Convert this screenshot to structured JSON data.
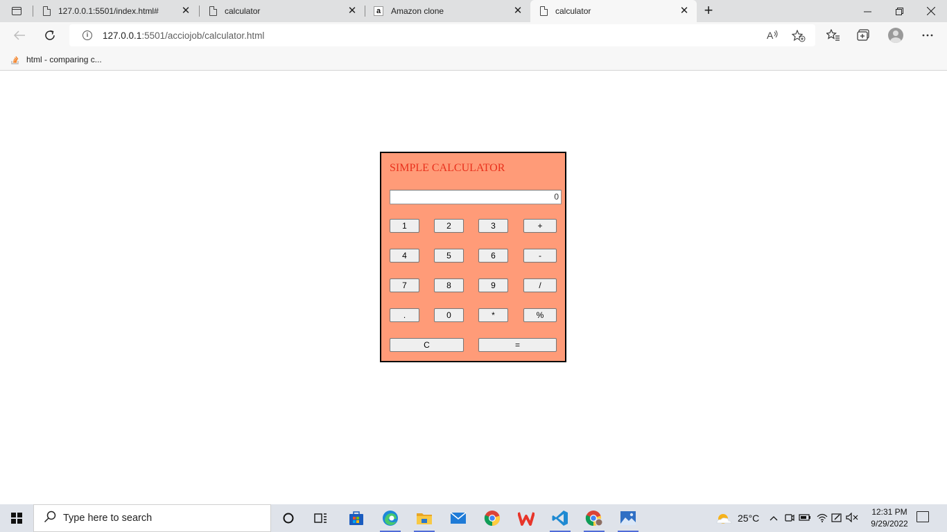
{
  "browser": {
    "tabs": [
      {
        "label": "127.0.0.1:5501/index.html#",
        "icon": "page-icon",
        "active": false
      },
      {
        "label": "calculator",
        "icon": "page-icon",
        "active": false
      },
      {
        "label": "Amazon clone",
        "icon": "amazon-icon",
        "active": false
      },
      {
        "label": "calculator",
        "icon": "page-icon",
        "active": true
      }
    ],
    "address": {
      "host": "127.0.0.1",
      "path": ":5501/acciojob/calculator.html"
    },
    "favorites": [
      {
        "label": "html - comparing c..."
      }
    ]
  },
  "calculator": {
    "title": "SIMPLE CALCULATOR",
    "display_value": "0",
    "buttons": {
      "b1": "1",
      "b2": "2",
      "b3": "3",
      "plus": "+",
      "b4": "4",
      "b5": "5",
      "b6": "6",
      "minus": "-",
      "b7": "7",
      "b8": "8",
      "b9": "9",
      "divide": "/",
      "dot": ".",
      "b0": "0",
      "multiply": "*",
      "percent": "%",
      "clear": "C",
      "equals": "="
    },
    "colors": {
      "panel_bg": "#ff9b78",
      "title_color": "#e9311c",
      "border": "#000000"
    }
  },
  "taskbar": {
    "search_placeholder": "Type here to search",
    "weather": "25°C",
    "time": "12:31 PM",
    "date": "9/29/2022"
  }
}
